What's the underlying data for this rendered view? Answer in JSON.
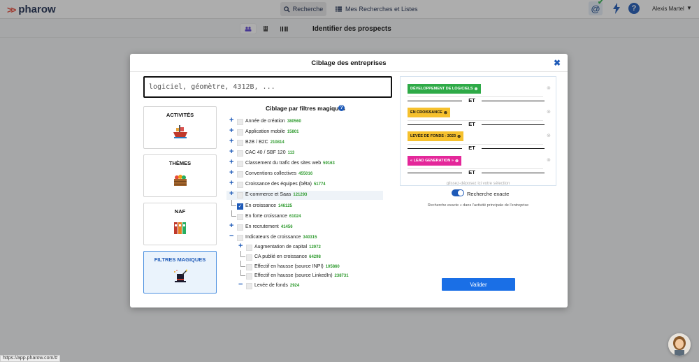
{
  "nav": {
    "logo": "pharow",
    "search": "Recherche",
    "lists": "Mes Recherches et Listes",
    "at_symbol": "@",
    "help_symbol": "?",
    "user": "Alexis Martel",
    "user_caret": "▼"
  },
  "subbar": {
    "title": "Identifier des prospects"
  },
  "modal": {
    "title": "Ciblage des entreprises",
    "close": "✖",
    "search_placeholder": "logiciel, géomètre, 4312B, ...",
    "categories": [
      {
        "label": "ACTIVITÉS",
        "icon": "ship-icon"
      },
      {
        "label": "THÈMES",
        "icon": "crate-icon"
      },
      {
        "label": "NAF",
        "icon": "binders-icon"
      },
      {
        "label": "FILTRES MAGIQUES",
        "icon": "magic-hat-icon",
        "active": true
      }
    ],
    "tree_title": "Ciblage par filtres magiques",
    "tree": [
      {
        "label": "Année de création",
        "count": "380560",
        "level": 0,
        "expander": "+"
      },
      {
        "label": "Application mobile",
        "count": "15801",
        "level": 0,
        "expander": "+"
      },
      {
        "label": "B2B / B2C",
        "count": "210814",
        "level": 0,
        "expander": "+"
      },
      {
        "label": "CAC 40 / SBF 120",
        "count": "113",
        "level": 0,
        "expander": "+"
      },
      {
        "label": "Classement du trafic des sites web",
        "count": "59163",
        "level": 0,
        "expander": "+"
      },
      {
        "label": "Conventions collectives",
        "count": "455016",
        "level": 0,
        "expander": "+"
      },
      {
        "label": "Croissance des équipes (bêta)",
        "count": "51774",
        "level": 0,
        "expander": "+"
      },
      {
        "label": "E-commerce et Saas",
        "count": "121293",
        "level": 0,
        "expander": "+",
        "highlight": true
      },
      {
        "label": "En croissance",
        "count": "146125",
        "level": 1,
        "checked": true
      },
      {
        "label": "En forte croissance",
        "count": "61024",
        "level": 1
      },
      {
        "label": "En recrutement",
        "count": "41456",
        "level": 0,
        "expander": "+"
      },
      {
        "label": "Indicateurs de croissance",
        "count": "340315",
        "level": 0,
        "expander": "−"
      },
      {
        "label": "Augmentation de capital",
        "count": "12972",
        "level": 1,
        "expander": "+"
      },
      {
        "label": "CA publié en croissance",
        "count": "64298",
        "level": 2
      },
      {
        "label": "Effectif en hausse (source INPI)",
        "count": "105860",
        "level": 2
      },
      {
        "label": "Effectif en hausse (source LinkedIn)",
        "count": "238731",
        "level": 2
      },
      {
        "label": "Levée de fonds",
        "count": "2924",
        "level": 1,
        "expander": "−"
      }
    ],
    "selected": [
      {
        "label": "DÉVELOPPEMENT DE LOGICIELS",
        "color": "#2eaa47",
        "style": "green"
      },
      {
        "label": "EN CROISSANCE",
        "color": "#f6c12e",
        "style": "yellow"
      },
      {
        "label": "LEVÉE DE FONDS - 2023",
        "color": "#f6c12e",
        "style": "yellow"
      },
      {
        "label": "« LEAD GENERATION »",
        "color": "#e4279a",
        "style": "pink"
      }
    ],
    "tag_remove": "⊗",
    "row_remove": "⊗",
    "operator": "ET",
    "drop_hint": "glissez-déposez ici votre sélection",
    "exact_label": "Recherche exacte",
    "exact_hint": "Recherche exacte « dans l'activité principale de l'entreprise",
    "validate": "Valider"
  },
  "status_url": "https://app.pharow.com/#"
}
